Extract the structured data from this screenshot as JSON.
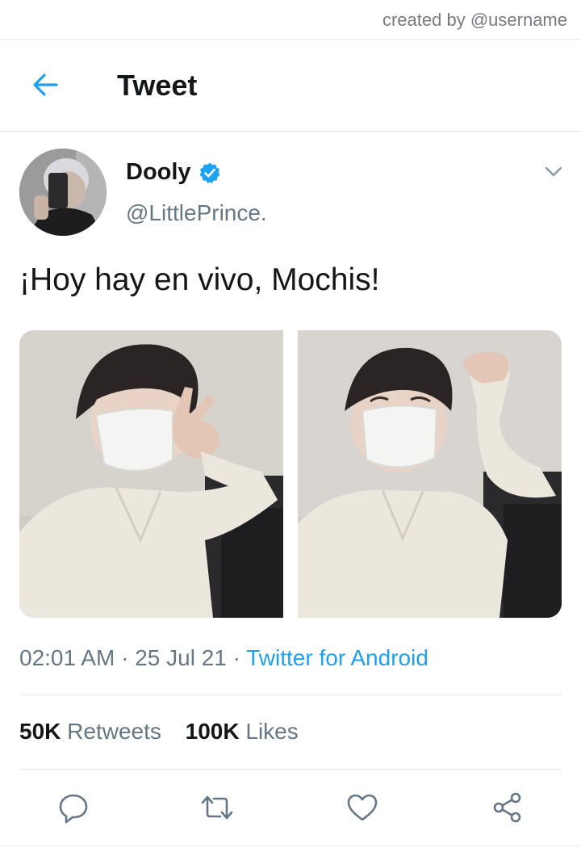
{
  "watermark": "created by @username",
  "header": {
    "title": "Tweet",
    "back_icon": "arrow-left-icon"
  },
  "colors": {
    "accent": "#1da1f2",
    "text_primary": "#14171a",
    "text_secondary": "#657786",
    "divider": "#e1e8ed"
  },
  "author": {
    "display_name": "Dooly",
    "handle": "@LittlePrince.",
    "verified": true,
    "verified_icon": "verified-badge-icon",
    "menu_icon": "chevron-down-icon"
  },
  "tweet": {
    "text": "¡Hoy hay en vivo, Mochis!",
    "photo_count": 2
  },
  "meta": {
    "time": "02:01 AM",
    "separator": " · ",
    "date": "25 Jul 21",
    "source": "Twitter for Android"
  },
  "stats": {
    "retweets_count": "50K",
    "retweets_label": "Retweets",
    "likes_count": "100K",
    "likes_label": "Likes"
  },
  "actions": [
    {
      "name": "reply",
      "icon": "reply-bubble-icon"
    },
    {
      "name": "retweet",
      "icon": "retweet-icon"
    },
    {
      "name": "like",
      "icon": "heart-icon"
    },
    {
      "name": "share",
      "icon": "share-icon"
    }
  ]
}
